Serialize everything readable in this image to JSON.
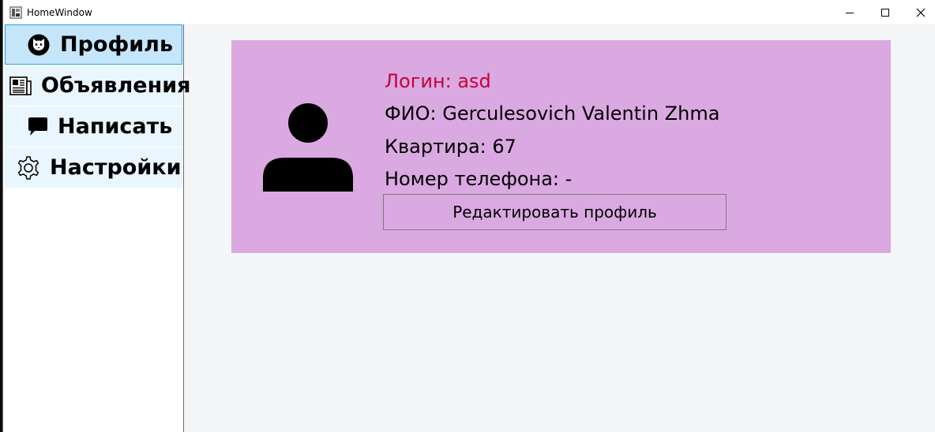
{
  "window": {
    "title": "HomeWindow"
  },
  "sidebar": {
    "items": [
      {
        "label": "Профиль",
        "icon": "cat-face-icon",
        "selected": true
      },
      {
        "label": "Объявления",
        "icon": "newspaper-icon",
        "selected": false
      },
      {
        "label": "Написать",
        "icon": "speech-bubble-icon",
        "selected": false
      },
      {
        "label": "Настройки",
        "icon": "gear-icon",
        "selected": false
      }
    ]
  },
  "profile": {
    "login": "Логин: asd",
    "fio": "ФИО: Gerculesovich Valentin Zhma",
    "apartment": "Квартира: 67",
    "phone": "Номер телефона: -",
    "edit_button_label": "Редактировать профиль",
    "avatar_icon": "user-silhouette-icon"
  },
  "colors": {
    "card_background": "#dba9e1",
    "login_text": "#c8003a",
    "nav_selected": "#c5e6fa",
    "nav_item": "#eaf6fd",
    "content_background": "#f4f5f7"
  }
}
